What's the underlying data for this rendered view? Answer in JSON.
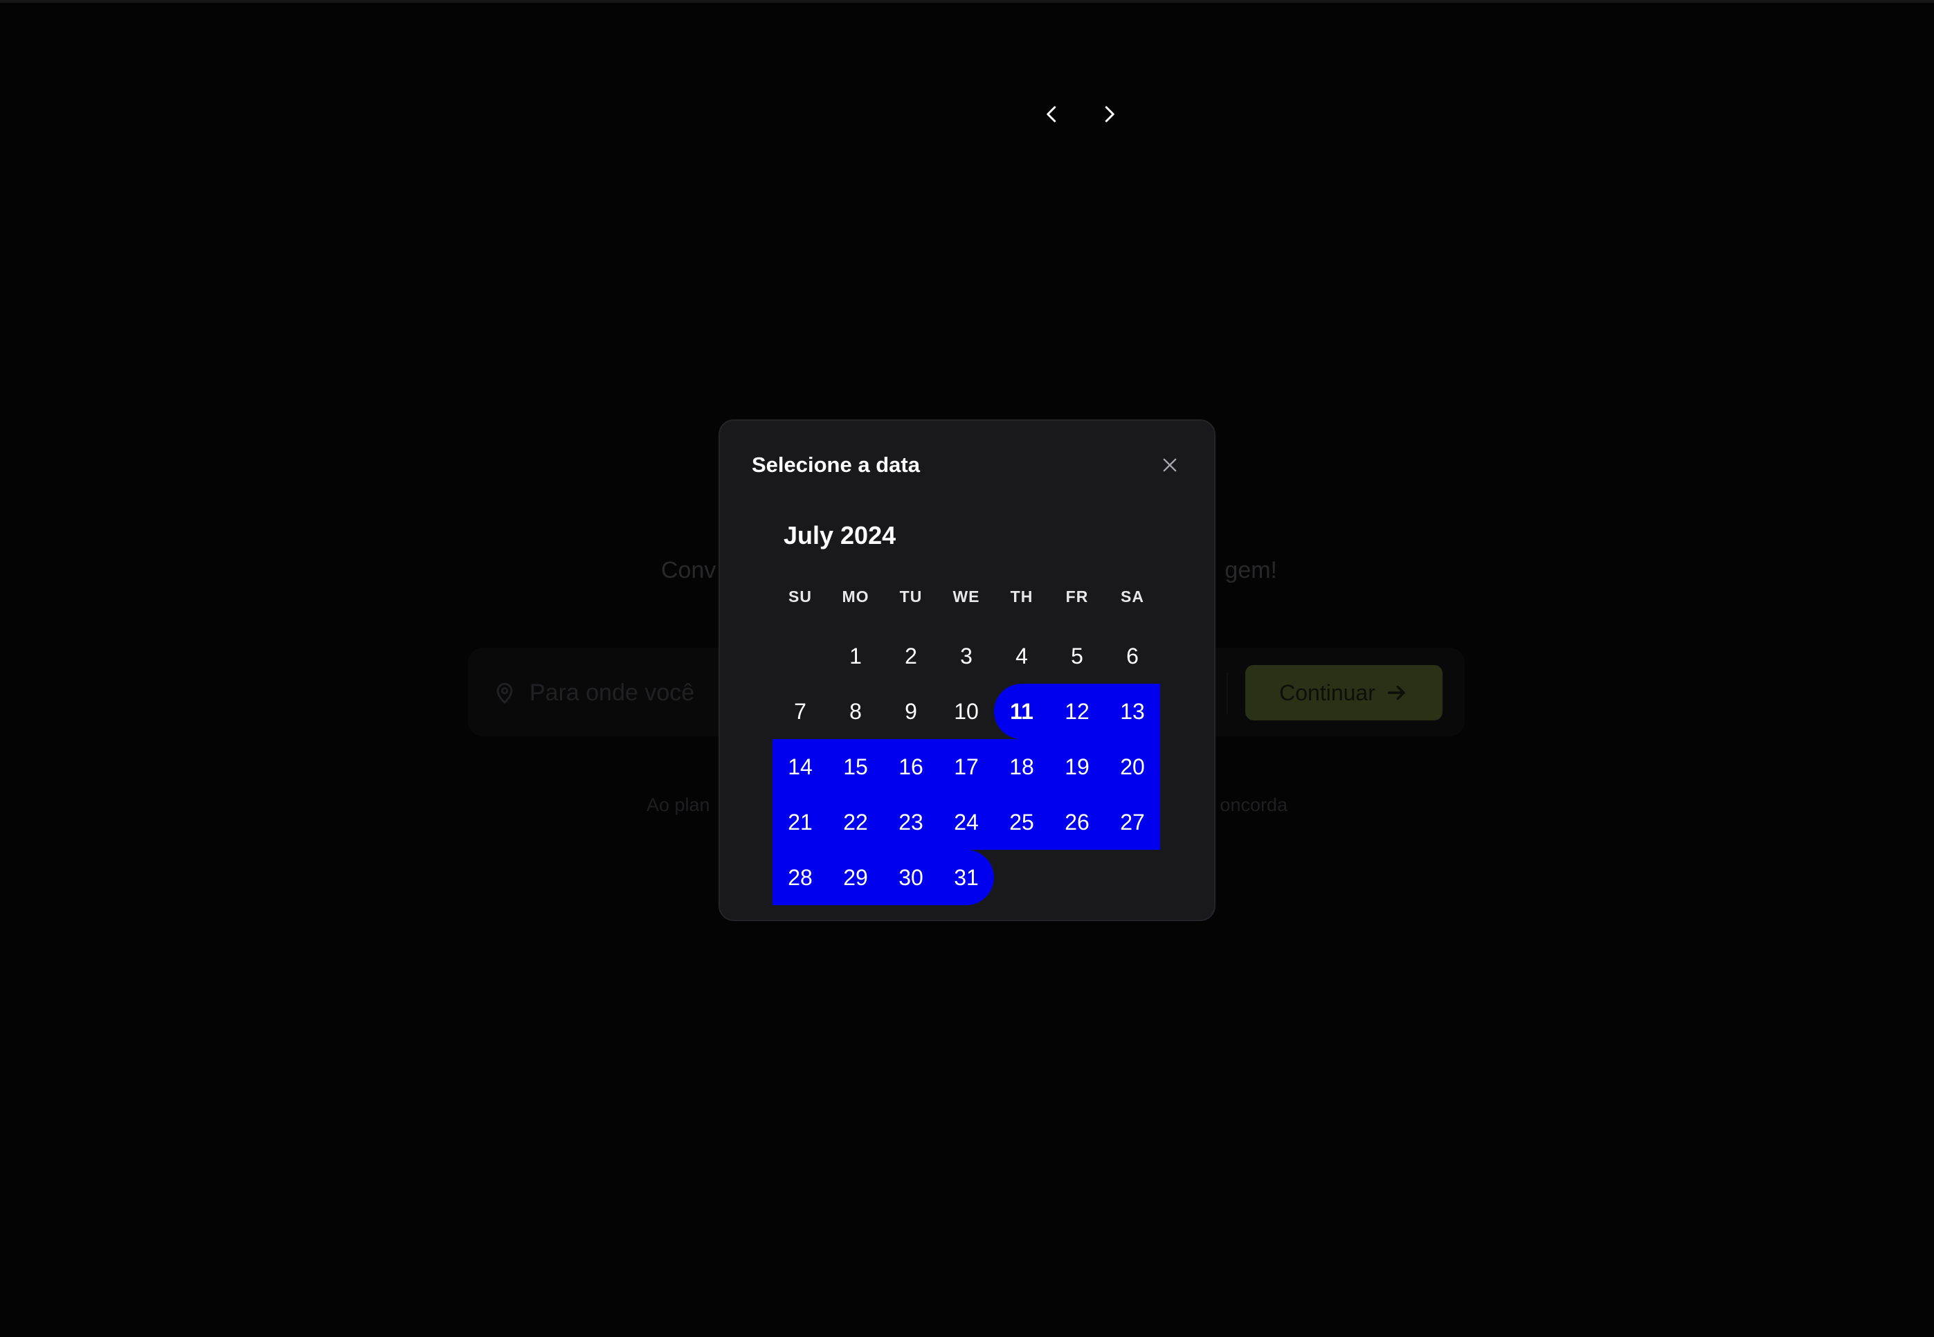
{
  "background": {
    "tagline_left": "Conv",
    "tagline_right": "gem!",
    "destination_placeholder": "Para onde você",
    "continue_label": "Continuar",
    "terms_left": "Ao plan",
    "terms_right": "oncorda",
    "accent_color": "#4d5a2a"
  },
  "modal": {
    "title": "Selecione a data",
    "month_label": "July 2024",
    "weekdays": [
      "SU",
      "MO",
      "TU",
      "WE",
      "TH",
      "FR",
      "SA"
    ],
    "weeks": [
      [
        "",
        "1",
        "2",
        "3",
        "4",
        "5",
        "6"
      ],
      [
        "7",
        "8",
        "9",
        "10",
        "11",
        "12",
        "13"
      ],
      [
        "14",
        "15",
        "16",
        "17",
        "18",
        "19",
        "20"
      ],
      [
        "21",
        "22",
        "23",
        "24",
        "25",
        "26",
        "27"
      ],
      [
        "28",
        "29",
        "30",
        "31",
        "",
        "",
        ""
      ]
    ],
    "range_start": 11,
    "range_end": 31,
    "range_color": "#0000ee"
  }
}
